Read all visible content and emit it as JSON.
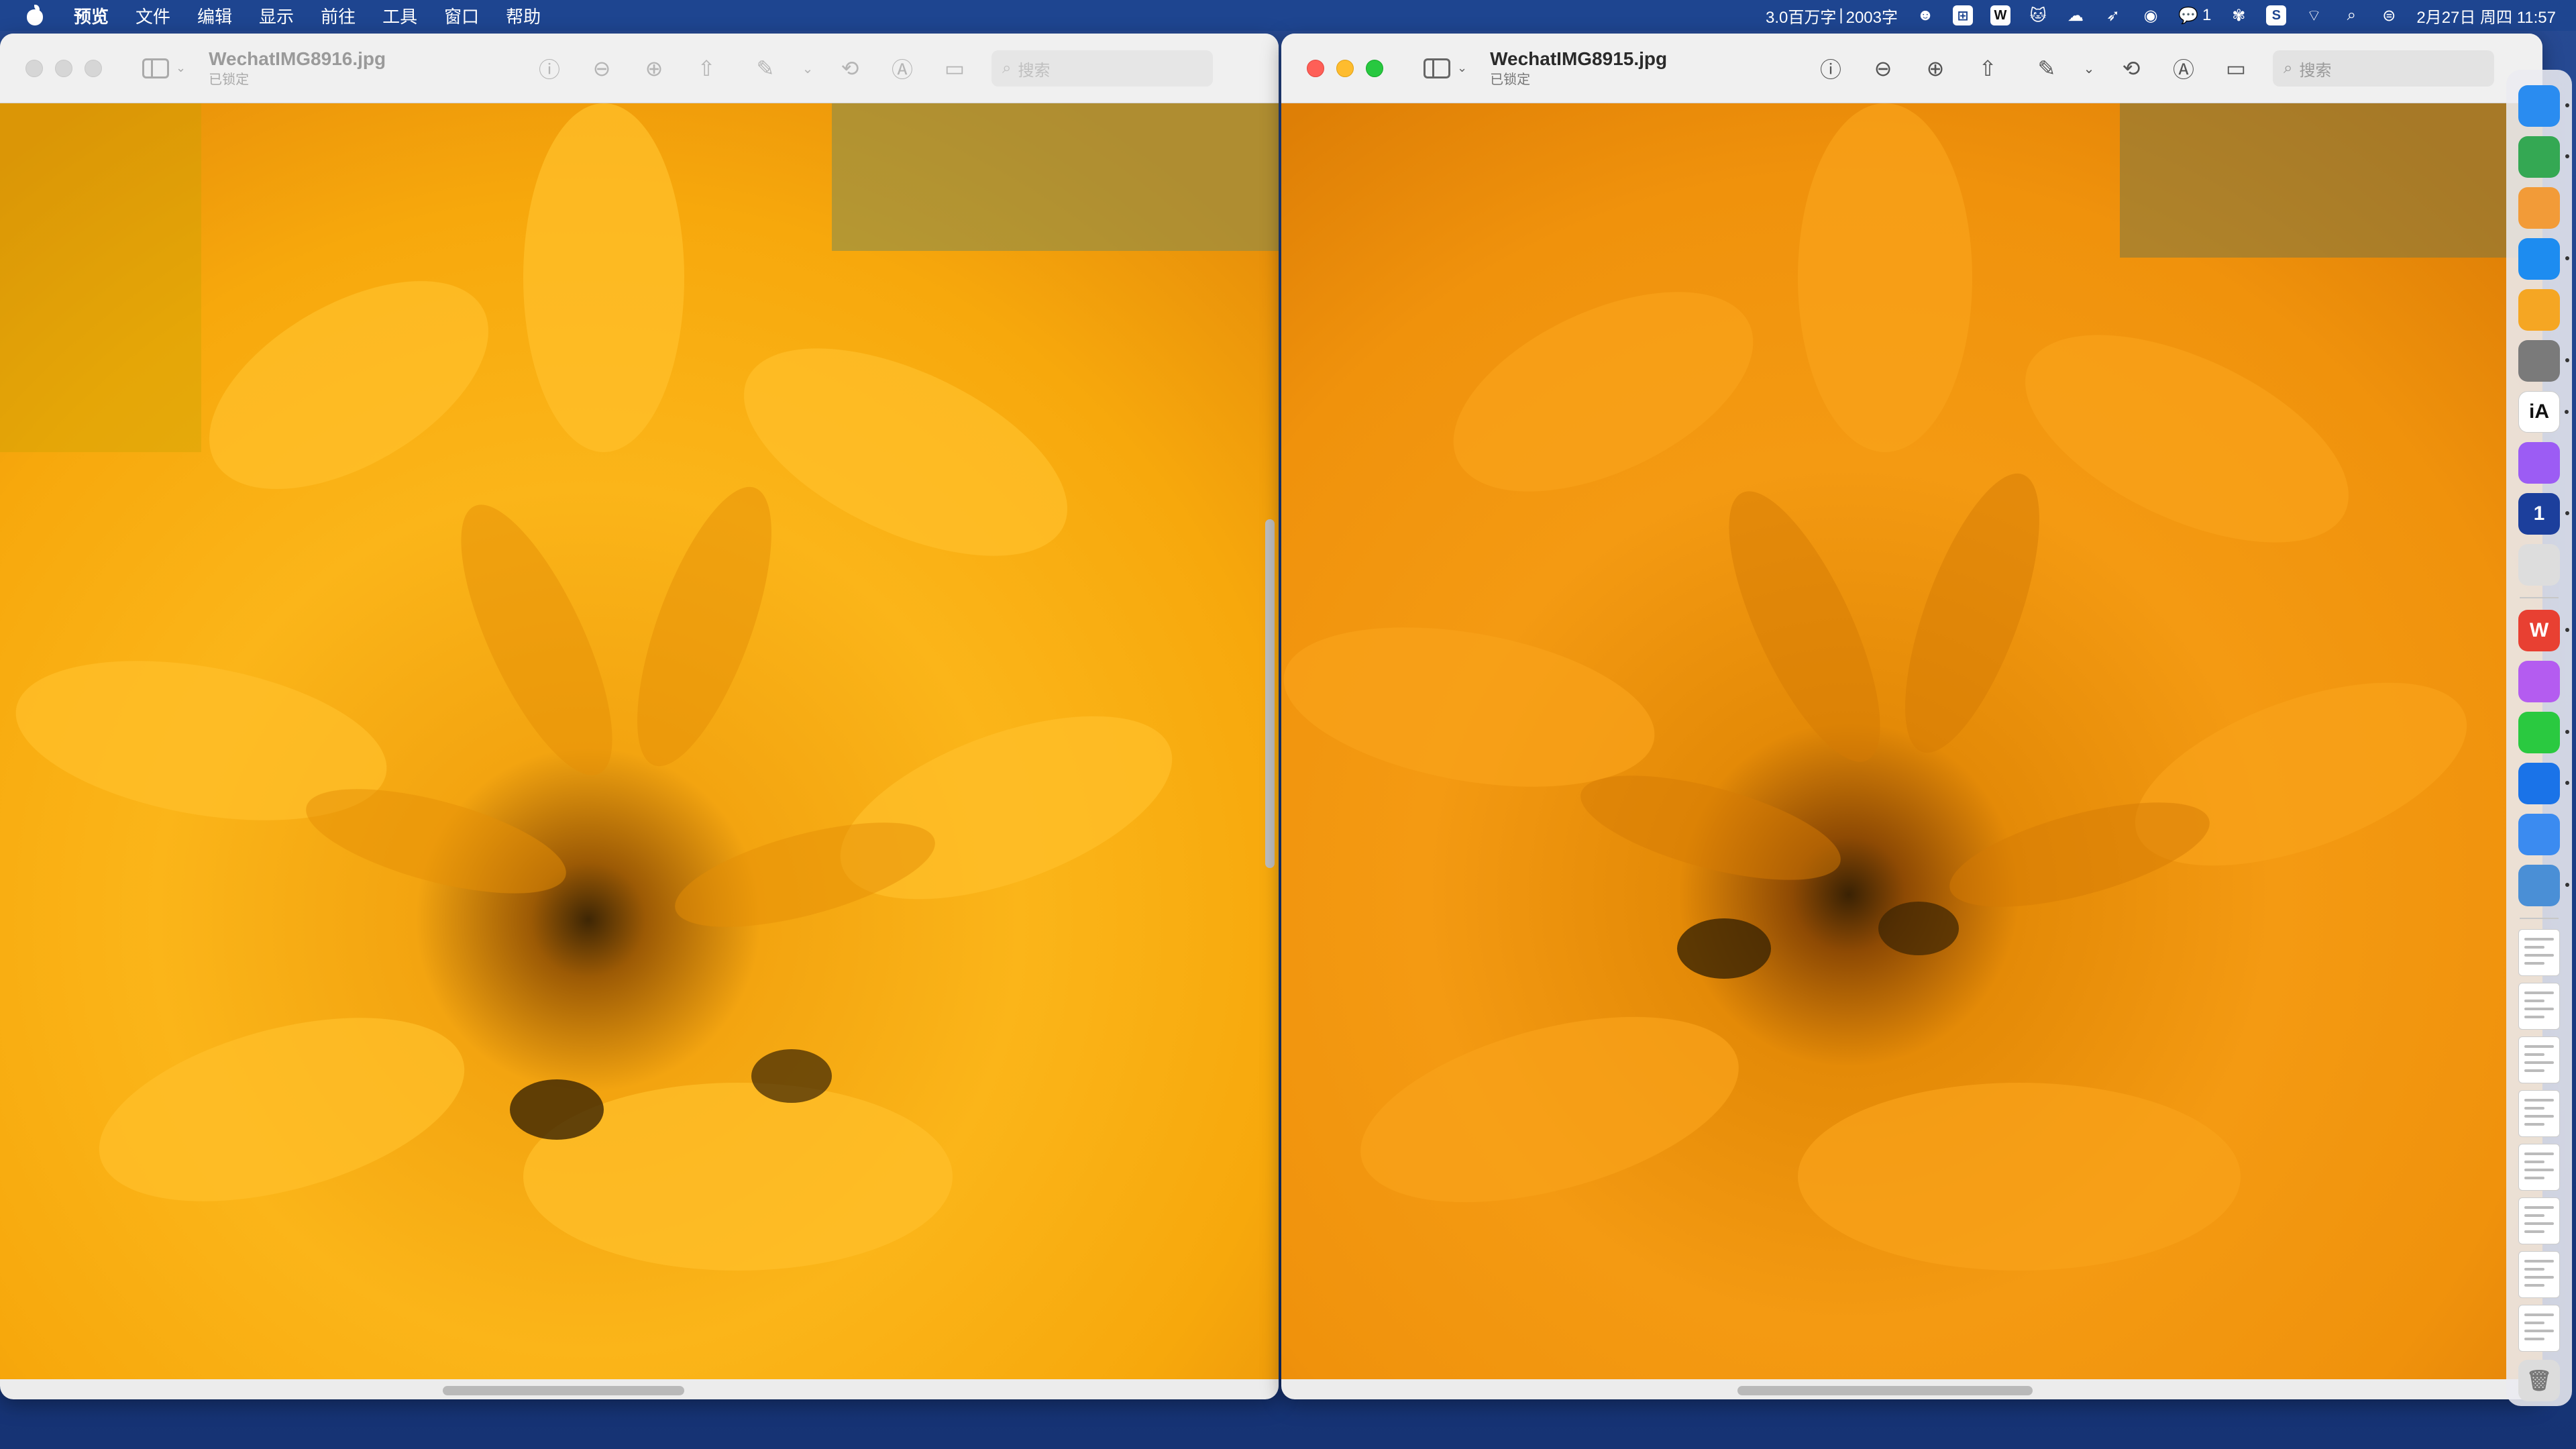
{
  "menubar": {
    "app_name": "预览",
    "menus": [
      "文件",
      "编辑",
      "显示",
      "前往",
      "工具",
      "窗口",
      "帮助"
    ],
    "status_left_text": "3.0百万字",
    "status_word_count": "2003字",
    "wechat_badge": "1",
    "datetime": "2月27日 周四 11:57"
  },
  "windows": {
    "left": {
      "filename": "WechatIMG8916.jpg",
      "status": "已锁定",
      "search_placeholder": "搜索",
      "active": false
    },
    "right": {
      "filename": "WechatIMG8915.jpg",
      "status": "已锁定",
      "search_placeholder": "搜索",
      "active": true
    }
  },
  "toolbar_icons": [
    "info-icon",
    "zoom-out-icon",
    "zoom-in-icon",
    "share-icon",
    "markup-pen-icon",
    "markup-menu-chevron-icon",
    "rotate-icon",
    "annotate-icon",
    "form-fill-icon"
  ],
  "dock": {
    "apps": [
      {
        "name": "finder-icon",
        "color": "#2a8cf0",
        "running": true
      },
      {
        "name": "google-drive-icon",
        "color": "#34a853",
        "running": true
      },
      {
        "name": "launchpad-icon",
        "color": "#f29b38",
        "running": false
      },
      {
        "name": "safari-icon",
        "color": "#1d8cf0",
        "running": true
      },
      {
        "name": "photos-icon",
        "color": "#f5a623",
        "running": false
      },
      {
        "name": "system-settings-icon",
        "color": "#7a7a7a",
        "running": true
      },
      {
        "name": "ia-writer-icon",
        "color": "#ffffff",
        "running": true,
        "glyph": "iA"
      },
      {
        "name": "cat-app-icon",
        "color": "#9c5cf4",
        "running": false
      },
      {
        "name": "onepassword-icon",
        "color": "#1c3f9c",
        "running": true,
        "glyph": "1"
      },
      {
        "name": "iphone-mirroring-icon",
        "color": "#dddddd",
        "running": false
      }
    ],
    "apps2": [
      {
        "name": "wps-office-icon",
        "color": "#e84032",
        "running": true,
        "glyph": "W"
      },
      {
        "name": "brain-app-icon",
        "color": "#b45cf0",
        "running": false
      },
      {
        "name": "wechat-icon",
        "color": "#2ac940",
        "running": true
      },
      {
        "name": "chat-bubble-icon",
        "color": "#1a73e8",
        "running": true
      },
      {
        "name": "cloud-sync-icon",
        "color": "#3b8bf0",
        "running": false
      },
      {
        "name": "preview-app-icon",
        "color": "#4a8fd6",
        "running": true
      }
    ],
    "thumbnails_count": 8
  }
}
